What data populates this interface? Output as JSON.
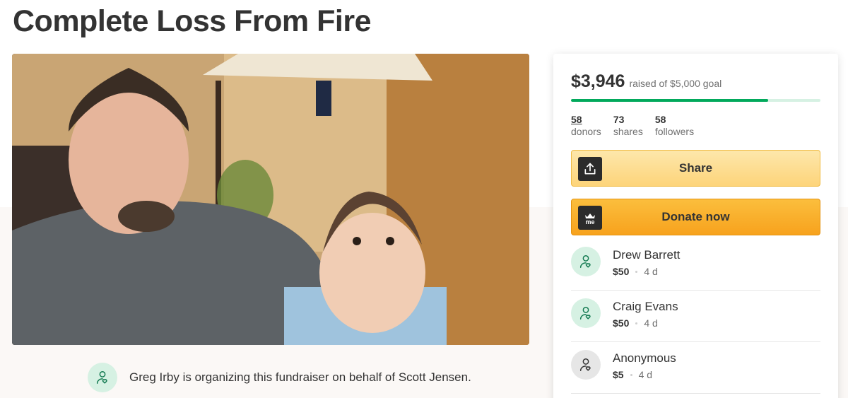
{
  "page": {
    "title": "Complete Loss From Fire"
  },
  "organizer": {
    "text": "Greg Irby is organizing this fundraiser on behalf of Scott Jensen.",
    "icon": "user-heart-icon"
  },
  "card": {
    "raised_amount": "$3,946",
    "raised_goal": "raised of $5,000 goal",
    "progress_fraction": 0.79,
    "stats": [
      {
        "num": "58",
        "label": "donors"
      },
      {
        "num": "73",
        "label": "shares"
      },
      {
        "num": "58",
        "label": "followers"
      }
    ],
    "share_label": "Share",
    "donate_label": "Donate now",
    "donate_icon_text": "me",
    "colors": {
      "progress_fill": "#02a95c",
      "progress_track": "#d6f1e3",
      "donate_button": "#f9ac28",
      "share_button": "#fddf95"
    }
  },
  "donations": [
    {
      "name": "Drew Barrett",
      "amount": "$50",
      "time": "4 d",
      "icon": "user-heart-icon"
    },
    {
      "name": "Craig Evans",
      "amount": "$50",
      "time": "4 d",
      "icon": "user-heart-icon"
    },
    {
      "name": "Anonymous",
      "amount": "$5",
      "time": "4 d",
      "icon": "user-heart-icon"
    }
  ]
}
